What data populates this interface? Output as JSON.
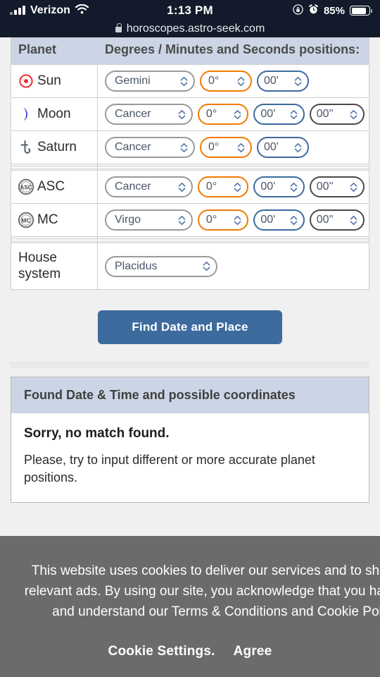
{
  "status_bar": {
    "carrier": "Verizon",
    "time": "1:13 PM",
    "battery_percent": "85%",
    "signal_icon": "cellular-signal-icon",
    "wifi_icon": "wifi-icon",
    "rotation_lock_icon": "rotation-lock-icon",
    "alarm_icon": "alarm-clock-icon",
    "battery_icon": "battery-icon"
  },
  "browser": {
    "url": "horoscopes.astro-seek.com",
    "lock_icon": "lock-icon"
  },
  "table": {
    "headers": {
      "planet": "Planet",
      "positions": "Degrees / Minutes and Seconds positions:"
    },
    "rows": [
      {
        "icon": "sun-icon",
        "name": "Sun",
        "sign": "Gemini",
        "degree": "0°",
        "minute": "00'",
        "second": null
      },
      {
        "icon": "moon-icon",
        "name": "Moon",
        "sign": "Cancer",
        "degree": "0°",
        "minute": "00'",
        "second": "00''"
      },
      {
        "icon": "saturn-icon",
        "name": "Saturn",
        "sign": "Cancer",
        "degree": "0°",
        "minute": "00'",
        "second": null
      },
      {
        "icon": "asc-icon",
        "name": "ASC",
        "sign": "Cancer",
        "degree": "0°",
        "minute": "00'",
        "second": "00''"
      },
      {
        "icon": "mc-icon",
        "name": "MC",
        "sign": "Virgo",
        "degree": "0°",
        "minute": "00'",
        "second": "00''"
      }
    ],
    "house_system": {
      "label": "House system",
      "value": "Placidus"
    }
  },
  "submit": {
    "label": "Find Date and Place"
  },
  "result_panel": {
    "title": "Found Date & Time and possible coordinates",
    "heading": "Sorry, no match found.",
    "body": "Please, try to input different or more accurate planet positions."
  },
  "cookie_banner": {
    "message": "This website uses cookies to deliver our services and to show you relevant ads. By using our site, you acknowledge that you have read and understand our Terms & Conditions and Cookie Policy.",
    "settings_label": "Cookie Settings",
    "settings_suffix": ".",
    "agree_label": "Agree"
  },
  "colors": {
    "header_bg": "#ccd5e5",
    "button_blue": "#3d6b9e",
    "degree_border": "#f07b00",
    "minute_border": "#3c6a9e",
    "second_border": "#4a4a4a",
    "banner_bg": "#6b6b6b",
    "chrome_bg": "#121a2b"
  }
}
